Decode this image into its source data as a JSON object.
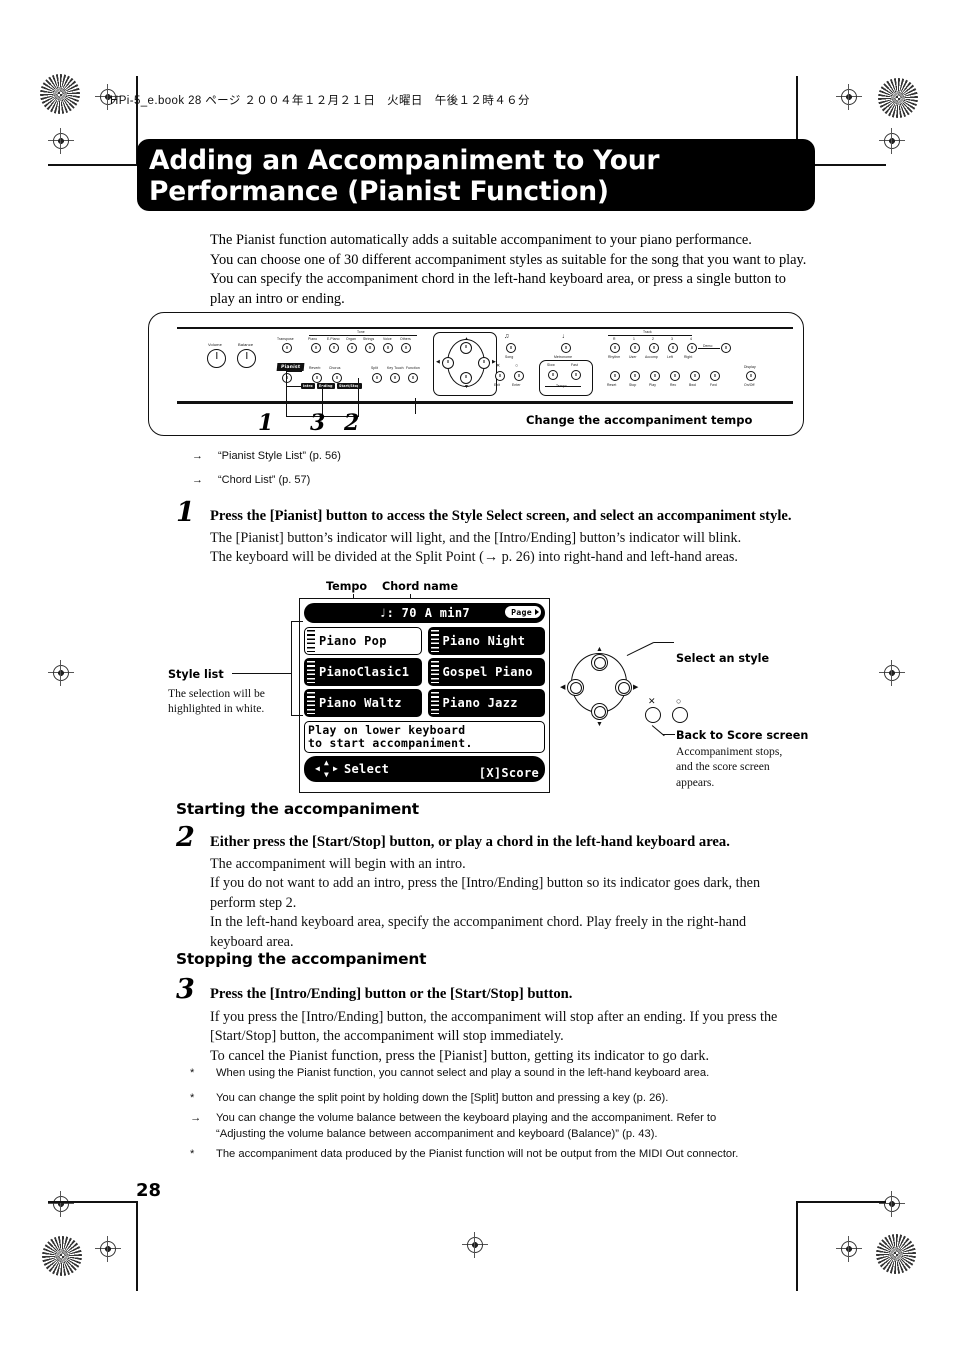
{
  "header": {
    "bookline": "HPi-5_e.book 28 ページ ２００４年１２月２１日　火曜日　午後１２時４６分"
  },
  "title": {
    "line1": "Adding an Accompaniment to Your",
    "line2": "Performance (Pianist Function)"
  },
  "intro": {
    "p1": "The Pianist function automatically adds a suitable accompaniment to your piano performance.",
    "p2": "You can choose one of 30 different accompaniment styles as suitable for the song that you want to play.",
    "p3": "You can specify the accompaniment chord in the left-hand keyboard area, or press a single button to play an intro or ending."
  },
  "panel": {
    "knob_labels": {
      "volume": "Volume",
      "balance": "Balance",
      "transpose": "Transpose",
      "piano": "Piano",
      "e_piano": "E.Piano",
      "organ": "Organ",
      "strings": "Strings",
      "voice": "Voice",
      "others": "Others",
      "tone_group": "Tone",
      "pianist": "Pianist",
      "reverb": "Reverb",
      "chorus": "Chorus",
      "split": "Split",
      "key_touch": "Key Touch",
      "function": "Function",
      "song": "Song",
      "metronome": "Metronome",
      "exit": "Exit",
      "enter": "Enter",
      "tempo_slow": "Slow",
      "tempo_fast": "Fast",
      "tempo_group": "Tempo",
      "track_group": "Track",
      "track_r": "R",
      "track_1": "1",
      "track_2": "2",
      "track_3": "3",
      "track_4": "4",
      "rhythm": "Rhythm",
      "user": "User",
      "accomp": "Accomp",
      "left": "Left",
      "right": "Right",
      "demo": "Demo",
      "reset": "Reset",
      "stop": "Stop",
      "play": "Play",
      "rec": "Rec",
      "bwd": "Bwd",
      "fwd": "Fwd",
      "display": "Display",
      "on_off": "On/Off"
    },
    "strip_labels": [
      "Intro",
      "Ending",
      "Start/Stop"
    ],
    "callouts": [
      {
        "num": "1"
      },
      {
        "num": "3"
      },
      {
        "num": "2"
      }
    ],
    "tempo_caption": "Change the accompaniment tempo"
  },
  "references": [
    {
      "arrow": "→",
      "text": "“Pianist Style List” (p. 56)"
    },
    {
      "arrow": "→",
      "text": "“Chord List” (p. 57)"
    }
  ],
  "steps": [
    {
      "num": "1",
      "head": "Press the [Pianist] button to access the Style Select screen, and select an accompaniment style.",
      "body_l1": "The [Pianist] button’s indicator will light, and the [Intro/Ending] button’s indicator will blink.",
      "body_l2": "The keyboard will be divided at the Split Point (→ p. 26) into right-hand and left-hand areas."
    },
    {
      "num": "2",
      "section": "Starting the accompaniment",
      "head": "Either press the [Start/Stop] button, or play a chord in the left-hand keyboard area.",
      "body_l1": "The accompaniment will begin with an intro.",
      "body_l2": "If you do not want to add an intro, press the [Intro/Ending] button so its indicator goes dark, then",
      "body_l3": "perform step 2.",
      "body_l4": "In the left-hand keyboard area, specify the accompaniment chord. Play freely in the right-hand",
      "body_l5": "keyboard area."
    },
    {
      "num": "3",
      "section": "Stopping the accompaniment",
      "head": "Press the [Intro/Ending] button or the [Start/Stop] button.",
      "body_l1": "If you press the [Intro/Ending] button, the accompaniment will stop after an ending. If you press the",
      "body_l2": "[Start/Stop] button, the accompaniment will stop immediately.",
      "body_l3": "To cancel the Pianist function, press the [Pianist] button, getting its indicator to go dark."
    }
  ],
  "lcd": {
    "callout_tempo": "Tempo",
    "callout_chord": "Chord name",
    "tempo_note": "♩",
    "tempo_value": ": 70",
    "chord_name": "A min7",
    "page_label": "Page",
    "styles": [
      {
        "name": "Piano Pop",
        "selected": true
      },
      {
        "name": "Piano Night",
        "selected": false
      },
      {
        "name": "PianoClasic1",
        "selected": false
      },
      {
        "name": "Gospel Piano",
        "selected": false
      },
      {
        "name": "Piano Waltz",
        "selected": false
      },
      {
        "name": "Piano Jazz",
        "selected": false
      }
    ],
    "message_l1": "Play on lower keyboard",
    "message_l2": "to start accompaniment.",
    "select_label": "Select",
    "score_label": "[X]Score"
  },
  "annotations": {
    "style_list_title": "Style list",
    "style_list_desc_l1": "The selection will be",
    "style_list_desc_l2": "highlighted in white.",
    "select_style": "Select an style",
    "back_to_score": "Back to Score screen",
    "back_desc_l1": "Accompaniment stops,",
    "back_desc_l2": "and the score screen",
    "back_desc_l3": "appears."
  },
  "notes": [
    {
      "mark": "*",
      "text": "When using the Pianist function, you cannot select and play a sound in the left-hand keyboard area."
    },
    {
      "mark": "*",
      "text": "You can change the split point by holding down the [Split] button and pressing a key (p. 26)."
    },
    {
      "mark": "→",
      "text": "You can change the volume balance between the keyboard playing and the accompaniment. Refer to “Adjusting the volume balance between accompaniment and keyboard (Balance)” (p. 43)."
    },
    {
      "mark": "*",
      "text": "The accompaniment data produced by the Pianist function will not be output from the MIDI Out connector."
    }
  ],
  "footer": {
    "page_number": "28"
  }
}
